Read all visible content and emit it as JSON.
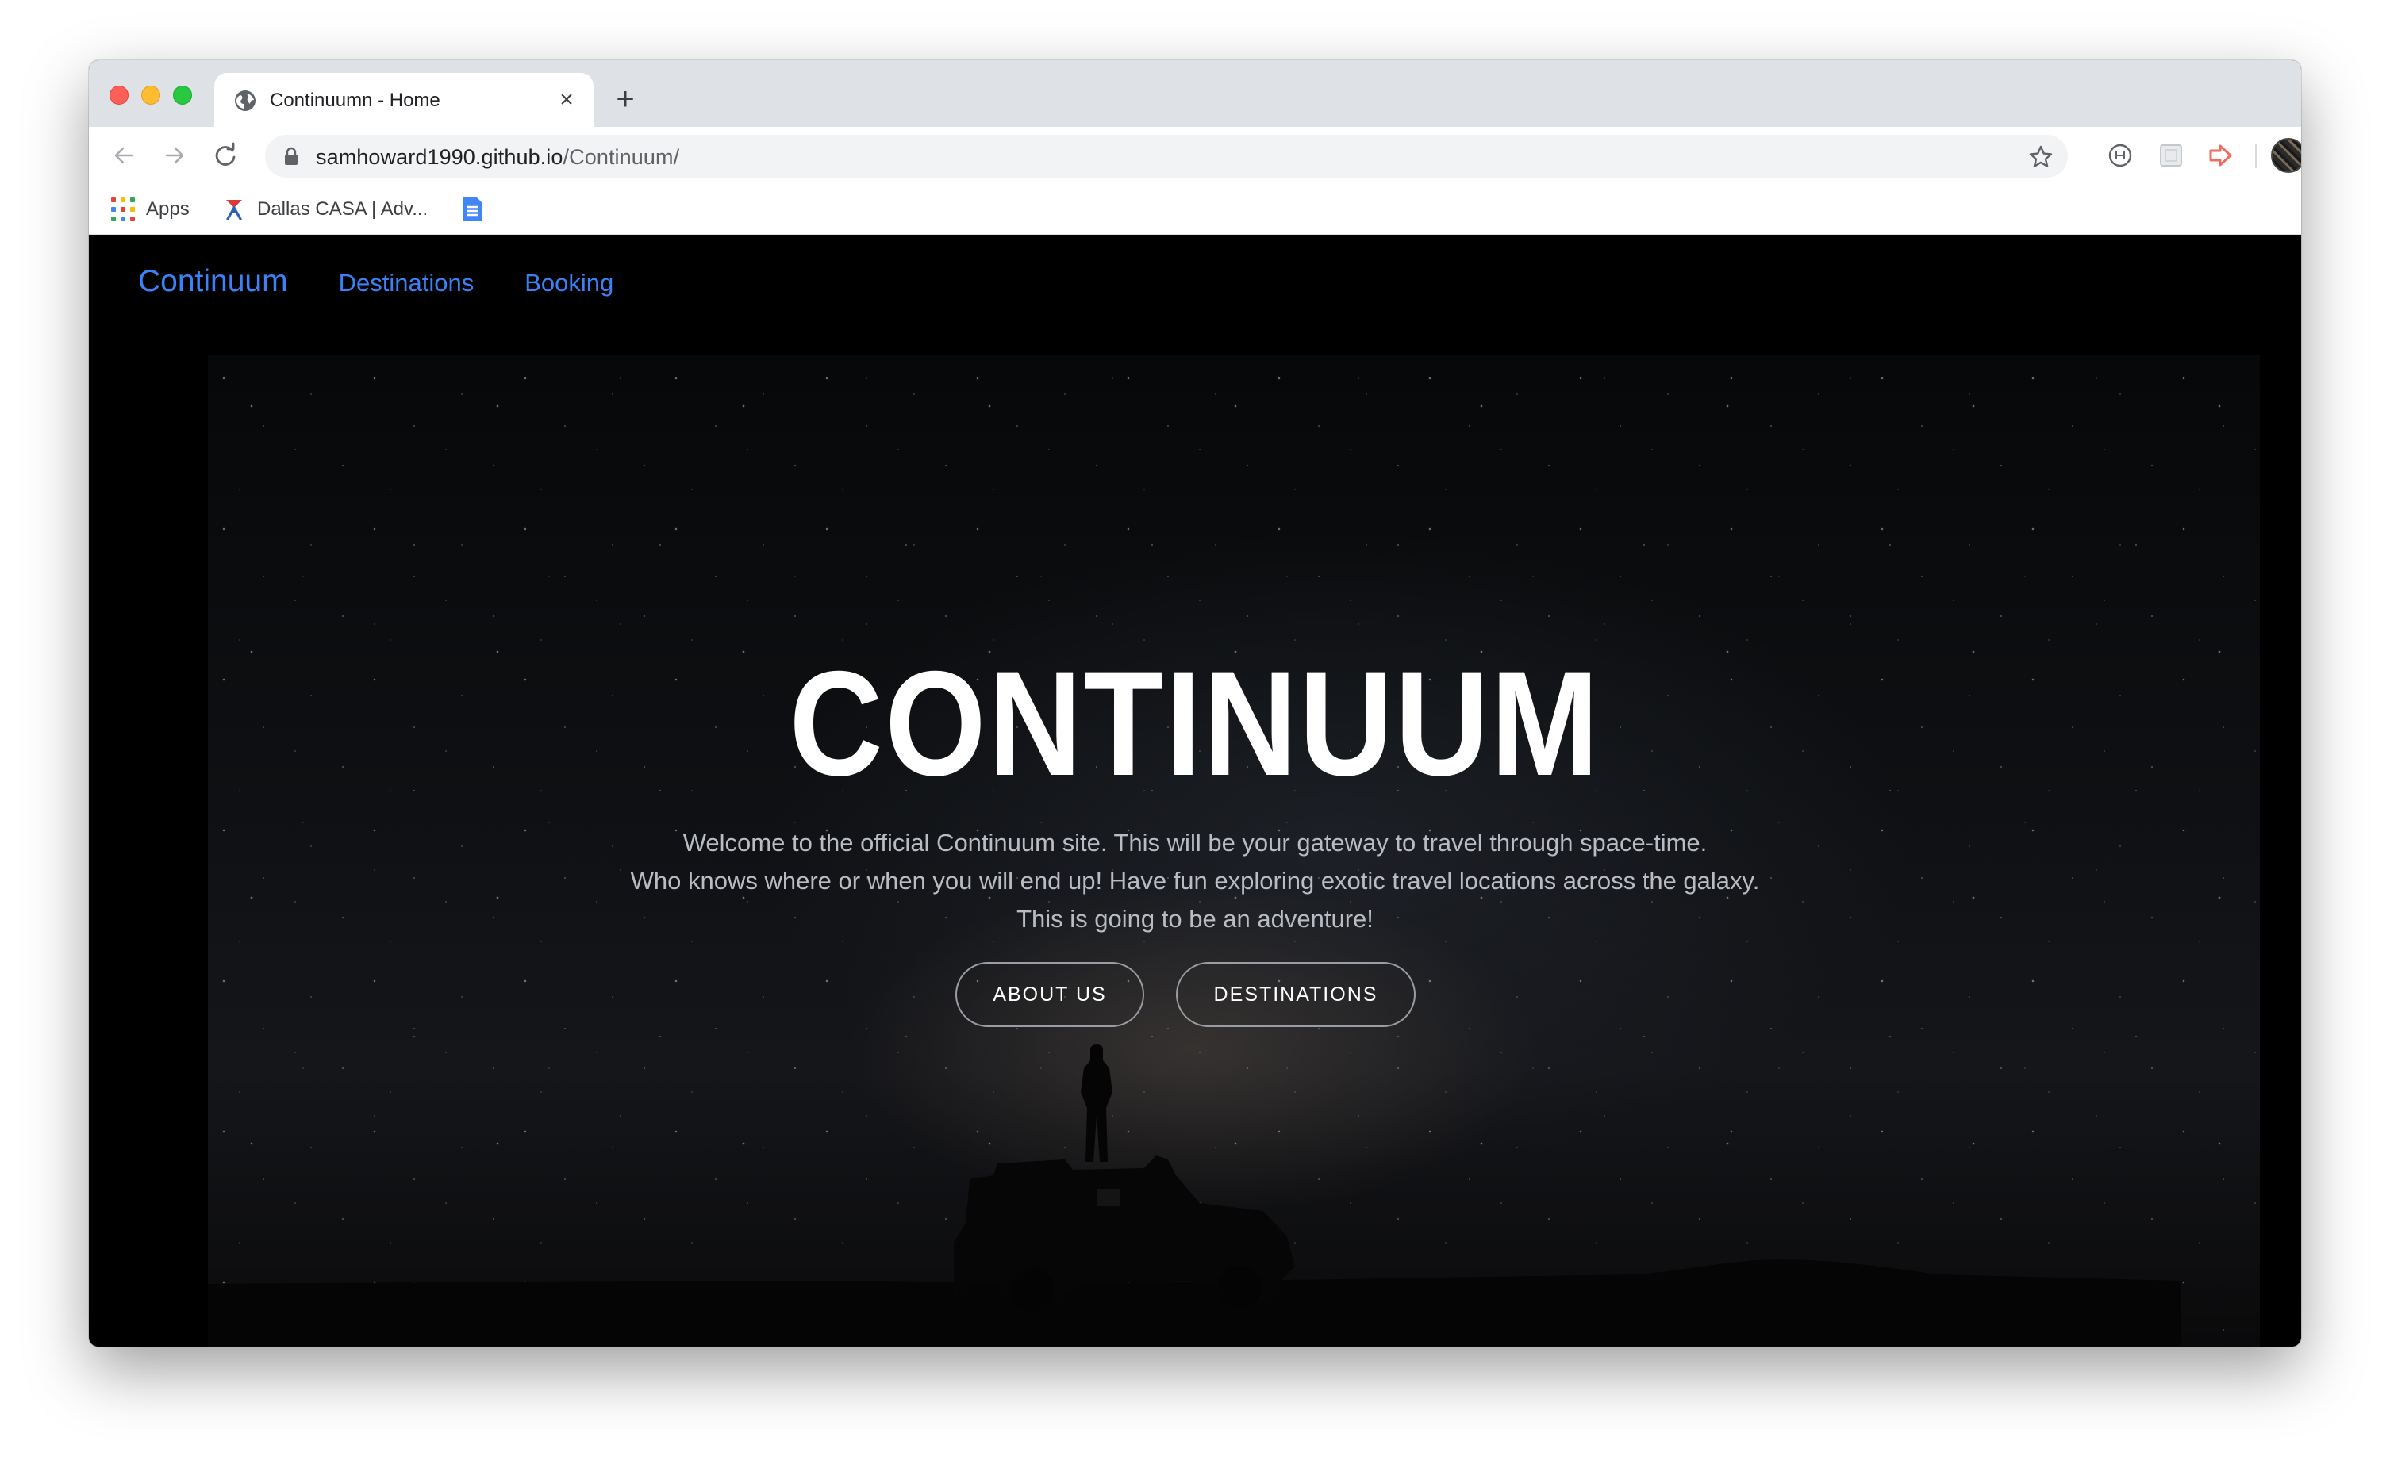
{
  "browser": {
    "tab_title": "Continuumn - Home",
    "url_host": "samhoward1990.github.io",
    "url_path": "/Continuum/",
    "new_tab_symbol": "+",
    "close_symbol": "×",
    "bookmarks": [
      {
        "label": "Apps",
        "icon": "apps-grid-icon"
      },
      {
        "label": "Dallas CASA | Adv...",
        "icon": "casa-logo-icon"
      },
      {
        "label": "",
        "icon": "google-docs-icon"
      }
    ],
    "extensions": [
      "extension-circle-icon",
      "extension-square-icon",
      "extension-arrow-icon"
    ],
    "colors": {
      "tabstrip": "#dee1e6",
      "toolbar": "#ffffff",
      "omnibox": "#f1f3f4"
    }
  },
  "site": {
    "nav": {
      "brand": "Continuum",
      "links": [
        "Destinations",
        "Booking"
      ]
    },
    "hero": {
      "title": "CONTINUUM",
      "lines": [
        "Welcome to the official Continuum site. This will be your gateway to travel through space-time.",
        "Who knows where or when you will end up! Have fun exploring exotic travel locations across the galaxy.",
        "This is going to be an adventure!"
      ],
      "buttons": [
        "ABOUT US",
        "DESTINATIONS"
      ]
    },
    "colors": {
      "link": "#3b82f6",
      "background": "#000000",
      "title": "#ffffff",
      "body_text": "#b9bcc2"
    }
  }
}
